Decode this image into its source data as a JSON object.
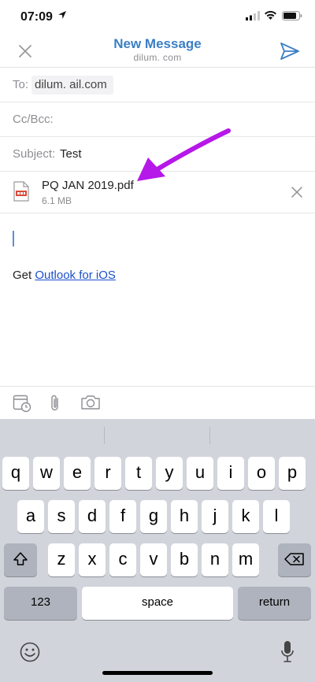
{
  "status_bar": {
    "time": "07:09"
  },
  "nav": {
    "title": "New Message",
    "account": "dilum.                                     com"
  },
  "compose": {
    "to_label": "To:",
    "to_value": "dilum.                    ail.com",
    "cc_label": "Cc/Bcc:",
    "subject_label": "Subject:",
    "subject_value": "Test"
  },
  "attachment": {
    "file_name": "PQ JAN 2019.pdf",
    "file_size": "6.1 MB"
  },
  "signature": {
    "prefix": "Get ",
    "link": "Outlook for iOS"
  },
  "toolbar": {
    "icons": [
      "calendar-clock-icon",
      "paperclip-icon",
      "camera-icon"
    ]
  },
  "keyboard": {
    "row1": [
      "q",
      "w",
      "e",
      "r",
      "t",
      "y",
      "u",
      "i",
      "o",
      "p"
    ],
    "row2": [
      "a",
      "s",
      "d",
      "f",
      "g",
      "h",
      "j",
      "k",
      "l"
    ],
    "row3": [
      "z",
      "x",
      "c",
      "v",
      "b",
      "n",
      "m"
    ],
    "numbers_key": "123",
    "space_key": "space",
    "return_key": "return"
  },
  "colors": {
    "accent": "#3c7fc4",
    "link": "#1a4fcc",
    "annotation_arrow": "#b518e8"
  }
}
